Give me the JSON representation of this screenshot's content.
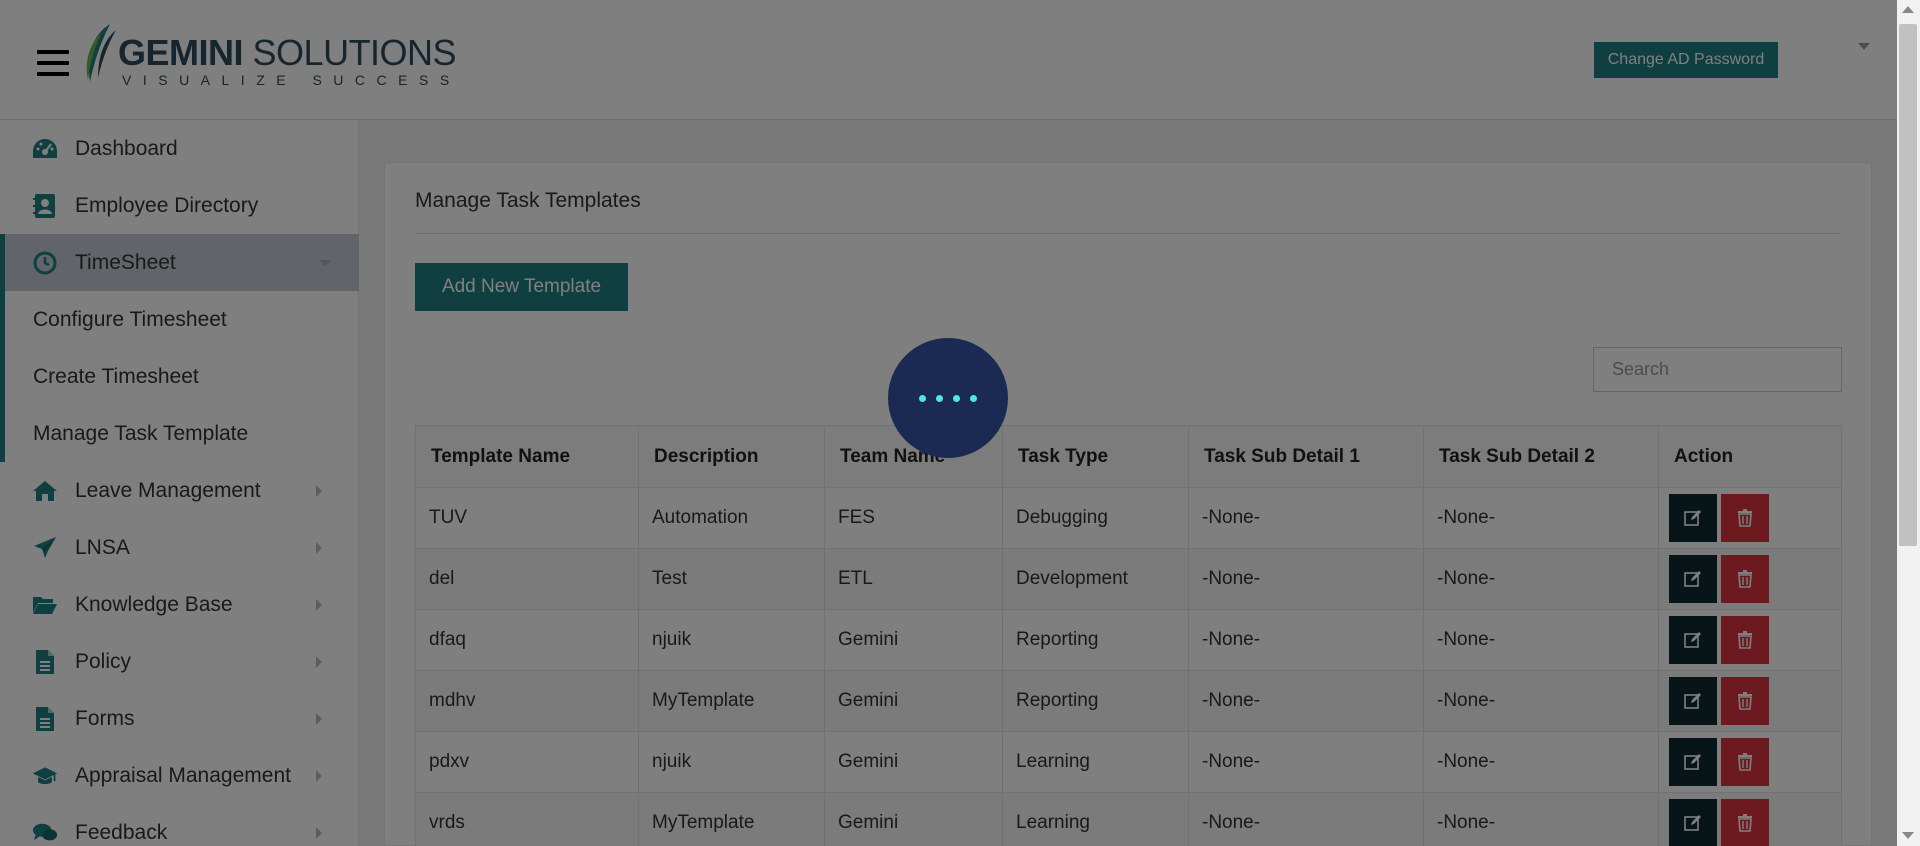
{
  "header": {
    "logo_name": "GEMINI SOLUTIONS",
    "logo_name_bold": "GEMINI",
    "logo_name_rest": "SOLUTIONS",
    "logo_tagline": "VISUALIZE SUCCESS",
    "ad_password_button": "Change AD Password"
  },
  "sidebar": {
    "items": [
      {
        "label": "Dashboard",
        "icon": "dashboard-icon"
      },
      {
        "label": "Employee Directory",
        "icon": "contacts-book-icon"
      },
      {
        "label": "TimeSheet",
        "icon": "clock-icon"
      },
      {
        "label": "Leave Management",
        "icon": "home-icon"
      },
      {
        "label": "LNSA",
        "icon": "paper-plane-icon"
      },
      {
        "label": "Knowledge Base",
        "icon": "folder-open-icon"
      },
      {
        "label": "Policy",
        "icon": "document-icon"
      },
      {
        "label": "Forms",
        "icon": "document-icon"
      },
      {
        "label": "Appraisal Management",
        "icon": "graduation-cap-icon"
      },
      {
        "label": "Feedback",
        "icon": "chat-icon"
      }
    ],
    "timesheet_sub": [
      {
        "label": "Configure Timesheet"
      },
      {
        "label": "Create Timesheet"
      },
      {
        "label": "Manage Task Template"
      }
    ]
  },
  "main": {
    "title": "Manage Task Templates",
    "add_button": "Add New Template",
    "search_placeholder": "Search",
    "table": {
      "columns": [
        "Template Name",
        "Description",
        "Team Name",
        "Task Type",
        "Task Sub Detail 1",
        "Task Sub Detail 2",
        "Action"
      ],
      "rows": [
        [
          "TUV",
          "Automation",
          "FES",
          "Debugging",
          "-None-",
          "-None-"
        ],
        [
          "del",
          "Test",
          "ETL",
          "Development",
          "-None-",
          "-None-"
        ],
        [
          "dfaq",
          "njuik",
          "Gemini",
          "Reporting",
          "-None-",
          "-None-"
        ],
        [
          "mdhv",
          "MyTemplate",
          "Gemini",
          "Reporting",
          "-None-",
          "-None-"
        ],
        [
          "pdxv",
          "njuik",
          "Gemini",
          "Learning",
          "-None-",
          "-None-"
        ],
        [
          "vrds",
          "MyTemplate",
          "Gemini",
          "Learning",
          "-None-",
          "-None-"
        ]
      ]
    }
  },
  "colors": {
    "accent": "#1e7e81",
    "edit_button": "#0e2a33",
    "delete_button": "#d8343f",
    "spinner_bg": "#1b2a52",
    "spinner_dots": "#4ee6e6"
  },
  "loading": true
}
